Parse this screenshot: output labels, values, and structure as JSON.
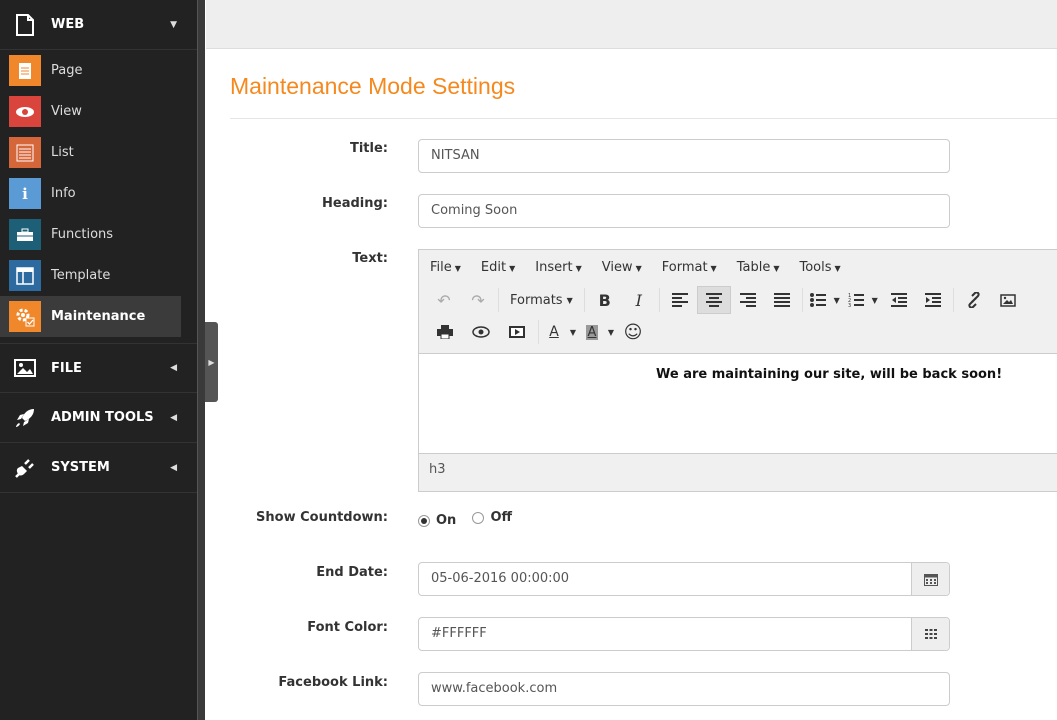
{
  "sidebar": {
    "sections": [
      {
        "label": "WEB",
        "icon": "file-icon",
        "caret": "▼"
      },
      {
        "label": "FILE",
        "icon": "image-icon",
        "caret": "◀"
      },
      {
        "label": "ADMIN TOOLS",
        "icon": "rocket-icon",
        "caret": "◀"
      },
      {
        "label": "SYSTEM",
        "icon": "plug-icon",
        "caret": "◀"
      }
    ],
    "web_items": [
      {
        "label": "Page",
        "icon": "page-icon",
        "color": "#f0882b"
      },
      {
        "label": "View",
        "icon": "eye-icon",
        "color": "#d9453d"
      },
      {
        "label": "List",
        "icon": "list-icon",
        "color": "#d4663a"
      },
      {
        "label": "Info",
        "icon": "info-icon",
        "color": "#5b9bd5"
      },
      {
        "label": "Functions",
        "icon": "briefcase-icon",
        "color": "#1e5f78"
      },
      {
        "label": "Template",
        "icon": "template-icon",
        "color": "#2d6a9f"
      },
      {
        "label": "Maintenance",
        "icon": "gear-icon",
        "color": "#f0882b",
        "active": true
      }
    ]
  },
  "page": {
    "title": "Maintenance Mode Settings"
  },
  "form": {
    "title_label": "Title:",
    "title_value": "NITSAN",
    "heading_label": "Heading:",
    "heading_value": "Coming Soon",
    "text_label": "Text:",
    "countdown_label": "Show Countdown:",
    "countdown_on": "On",
    "countdown_off": "Off",
    "enddate_label": "End Date:",
    "enddate_value": "05-06-2016 00:00:00",
    "fontcolor_label": "Font Color:",
    "fontcolor_value": "#FFFFFF",
    "facebook_label": "Facebook Link:",
    "facebook_value": "www.facebook.com"
  },
  "editor": {
    "menus": [
      "File",
      "Edit",
      "Insert",
      "View",
      "Format",
      "Table",
      "Tools"
    ],
    "formats_label": "Formats",
    "content": "We are maintaining our site, will be back soon!",
    "status_path": "h3"
  }
}
